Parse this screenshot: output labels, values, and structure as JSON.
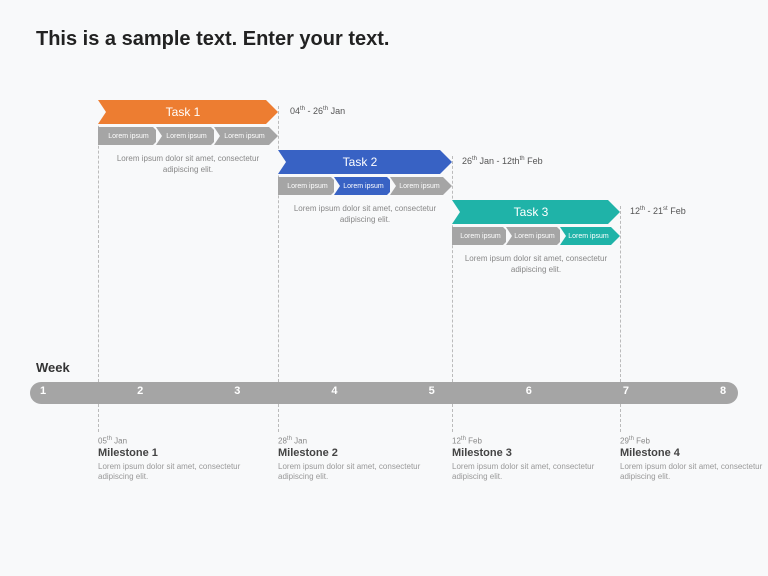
{
  "title": "This is a sample text. Enter your text.",
  "weekLabel": "Week",
  "weeks": [
    "1",
    "2",
    "3",
    "4",
    "5",
    "6",
    "7",
    "8"
  ],
  "tasks": [
    {
      "name": "Task 1",
      "color": "#ed7d31",
      "date_html": "04<sup>th</sup> - 26<sup>th</sup> Jan",
      "subs": [
        "Lorem ipsum",
        "Lorem ipsum",
        "Lorem ipsum"
      ],
      "sub_accent_index": -1,
      "desc": "Lorem ipsum dolor sit amet, consectetur adipiscing elit."
    },
    {
      "name": "Task 2",
      "color": "#3862c4",
      "date_html": "26<sup>th</sup> Jan - 12th<sup>th</sup> Feb",
      "subs": [
        "Lorem ipsum",
        "Lorem ipsum",
        "Lorem ipsum"
      ],
      "sub_accent_index": 1,
      "desc": "Lorem ipsum dolor sit amet, consectetur adipiscing elit."
    },
    {
      "name": "Task 3",
      "color": "#1fb3a8",
      "date_html": "12<sup>th</sup> - 21<sup>st</sup> Feb",
      "subs": [
        "Lorem ipsum",
        "Lorem ipsum",
        "Lorem ipsum"
      ],
      "sub_accent_index": 2,
      "desc": "Lorem ipsum dolor sit amet, consectetur adipiscing elit."
    }
  ],
  "milestones": [
    {
      "date_html": "05<sup>th</sup> Jan",
      "title": "Milestone 1",
      "desc": "Lorem ipsum dolor sit amet, consectetur adipiscing elit."
    },
    {
      "date_html": "28<sup>th</sup>  Jan",
      "title": "Milestone 2",
      "desc": "Lorem ipsum dolor sit amet, consectetur adipiscing elit."
    },
    {
      "date_html": "12<sup>th</sup>  Feb",
      "title": "Milestone 3",
      "desc": "Lorem ipsum dolor sit amet, consectetur adipiscing elit."
    },
    {
      "date_html": "29<sup>th</sup>  Feb",
      "title": "Milestone 4",
      "desc": "Lorem ipsum dolor sit amet, consectetur adipiscing elit."
    }
  ],
  "chart_data": {
    "type": "gantt",
    "x_unit": "week",
    "x_range": [
      1,
      8
    ],
    "tasks": [
      {
        "name": "Task 1",
        "start_week": 1,
        "end_week": 3.6,
        "date_range": "04th - 26th Jan",
        "color": "#ed7d31"
      },
      {
        "name": "Task 2",
        "start_week": 3.6,
        "end_week": 6.0,
        "date_range": "26th Jan - 12th Feb",
        "color": "#3862c4"
      },
      {
        "name": "Task 3",
        "start_week": 6.0,
        "end_week": 8.0,
        "date_range": "12th - 21st Feb",
        "color": "#1fb3a8"
      }
    ],
    "milestones": [
      {
        "name": "Milestone 1",
        "week": 1,
        "date": "05th Jan"
      },
      {
        "name": "Milestone 2",
        "week": 4,
        "date": "28th Jan"
      },
      {
        "name": "Milestone 3",
        "week": 6,
        "date": "12th Feb"
      },
      {
        "name": "Milestone 4",
        "week": 8,
        "date": "29th Feb"
      }
    ]
  }
}
